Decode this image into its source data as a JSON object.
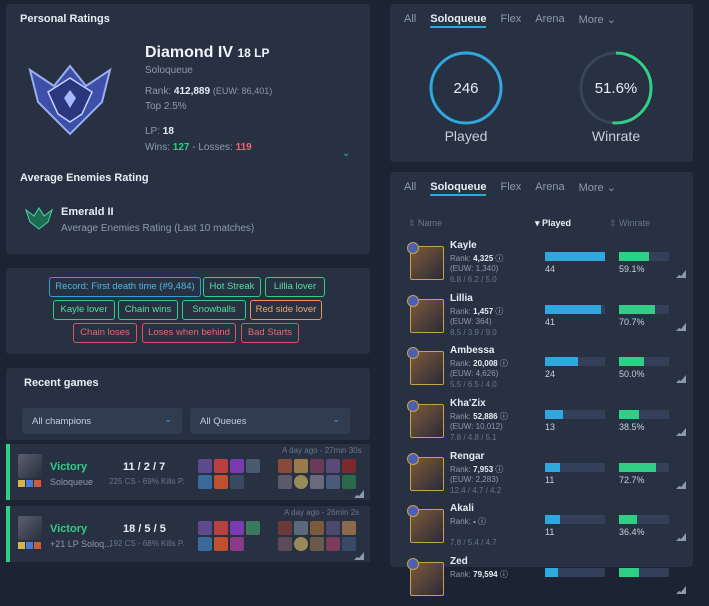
{
  "personal": {
    "title": "Personal Ratings",
    "tier": "Diamond IV",
    "lp_small": "18 LP",
    "queue": "Soloqueue",
    "rank_label": "Rank:",
    "rank": "412,889",
    "rank_euw": "(EUW: 86,401)",
    "top": "Top 2.5%",
    "lp_label": "LP:",
    "lp": "18",
    "wins_label": "Wins:",
    "wins": "127",
    "losses_label": "- Losses:",
    "losses": "119"
  },
  "enemies": {
    "title": "Average Enemies Rating",
    "tier": "Emerald II",
    "desc": "Average Enemies Rating (Last 10 matches)"
  },
  "tags": [
    {
      "label": "Record: First death time (#9,484)"
    },
    {
      "label": "Hot Streak"
    },
    {
      "label": "Lillia lover"
    },
    {
      "label": "Kayle lover"
    },
    {
      "label": "Chain wins"
    },
    {
      "label": "Snowballs"
    },
    {
      "label": "Red side lover"
    },
    {
      "label": "Chain loses"
    },
    {
      "label": "Loses when behind"
    },
    {
      "label": "Bad Starts"
    }
  ],
  "recent": {
    "title": "Recent games",
    "filter_champ": "All champions",
    "filter_queue": "All Queues"
  },
  "games": [
    {
      "result": "Victory",
      "queue": "Soloqueue",
      "kda": "11 / 2 / 7",
      "cs": "225 CS - 69% Kills P.",
      "time": "A day ago - 27min 30s"
    },
    {
      "result": "Victory",
      "queue": "+21 LP Soloq...",
      "kda": "18 / 5 / 5",
      "cs": "192 CS - 68% Kills P.",
      "time": "A day ago - 26min 2s"
    }
  ],
  "tabs_top": [
    "All",
    "Soloqueue",
    "Flex",
    "Arena",
    "More"
  ],
  "tabs_champ": [
    "All",
    "Soloqueue",
    "Flex",
    "Arena",
    "More"
  ],
  "summary": {
    "played": "246",
    "played_label": "Played",
    "winrate": "51.6%",
    "winrate_label": "Winrate",
    "winrate_fraction": 0.516
  },
  "table": {
    "col_name": "Name",
    "col_played": "Played",
    "col_winrate": "Winrate"
  },
  "champions": [
    {
      "name": "Kayle",
      "rank": "4,325",
      "euw": "(EUW: 1,340)",
      "kda": "6.8 / 6.2 / 5.0",
      "played": "44",
      "played_frac": 1.0,
      "winrate": "59.1%",
      "wr_frac": 0.59
    },
    {
      "name": "Lillia",
      "rank": "1,457",
      "euw": "(EUW: 364)",
      "kda": "8.5 / 3.9 / 9.0",
      "played": "41",
      "played_frac": 0.93,
      "winrate": "70.7%",
      "wr_frac": 0.71
    },
    {
      "name": "Ambessa",
      "rank": "20,008",
      "euw": "(EUW: 4,626)",
      "kda": "5.5 / 6.5 / 4.0",
      "played": "24",
      "played_frac": 0.55,
      "winrate": "50.0%",
      "wr_frac": 0.5
    },
    {
      "name": "Kha'Zix",
      "rank": "52,886",
      "euw": "(EUW: 10,012)",
      "kda": "7.8 / 4.8 / 5.1",
      "played": "13",
      "played_frac": 0.3,
      "winrate": "38.5%",
      "wr_frac": 0.39
    },
    {
      "name": "Rengar",
      "rank": "7,953",
      "euw": "(EUW: 2,283)",
      "kda": "12.4 / 4.7 / 4.2",
      "played": "11",
      "played_frac": 0.25,
      "winrate": "72.7%",
      "wr_frac": 0.73
    },
    {
      "name": "Akali",
      "rank": "-",
      "euw": "",
      "kda": "7.8 / 5.4 / 4.7",
      "played": "11",
      "played_frac": 0.25,
      "winrate": "36.4%",
      "wr_frac": 0.36
    },
    {
      "name": "Zed",
      "rank": "79,594",
      "euw": "",
      "kda": "",
      "played": "",
      "played_frac": 0.22,
      "winrate": "",
      "wr_frac": 0.4
    }
  ],
  "colors": {
    "accent": "#31a7e0",
    "win": "#2fcf86",
    "loss": "#e86970"
  }
}
